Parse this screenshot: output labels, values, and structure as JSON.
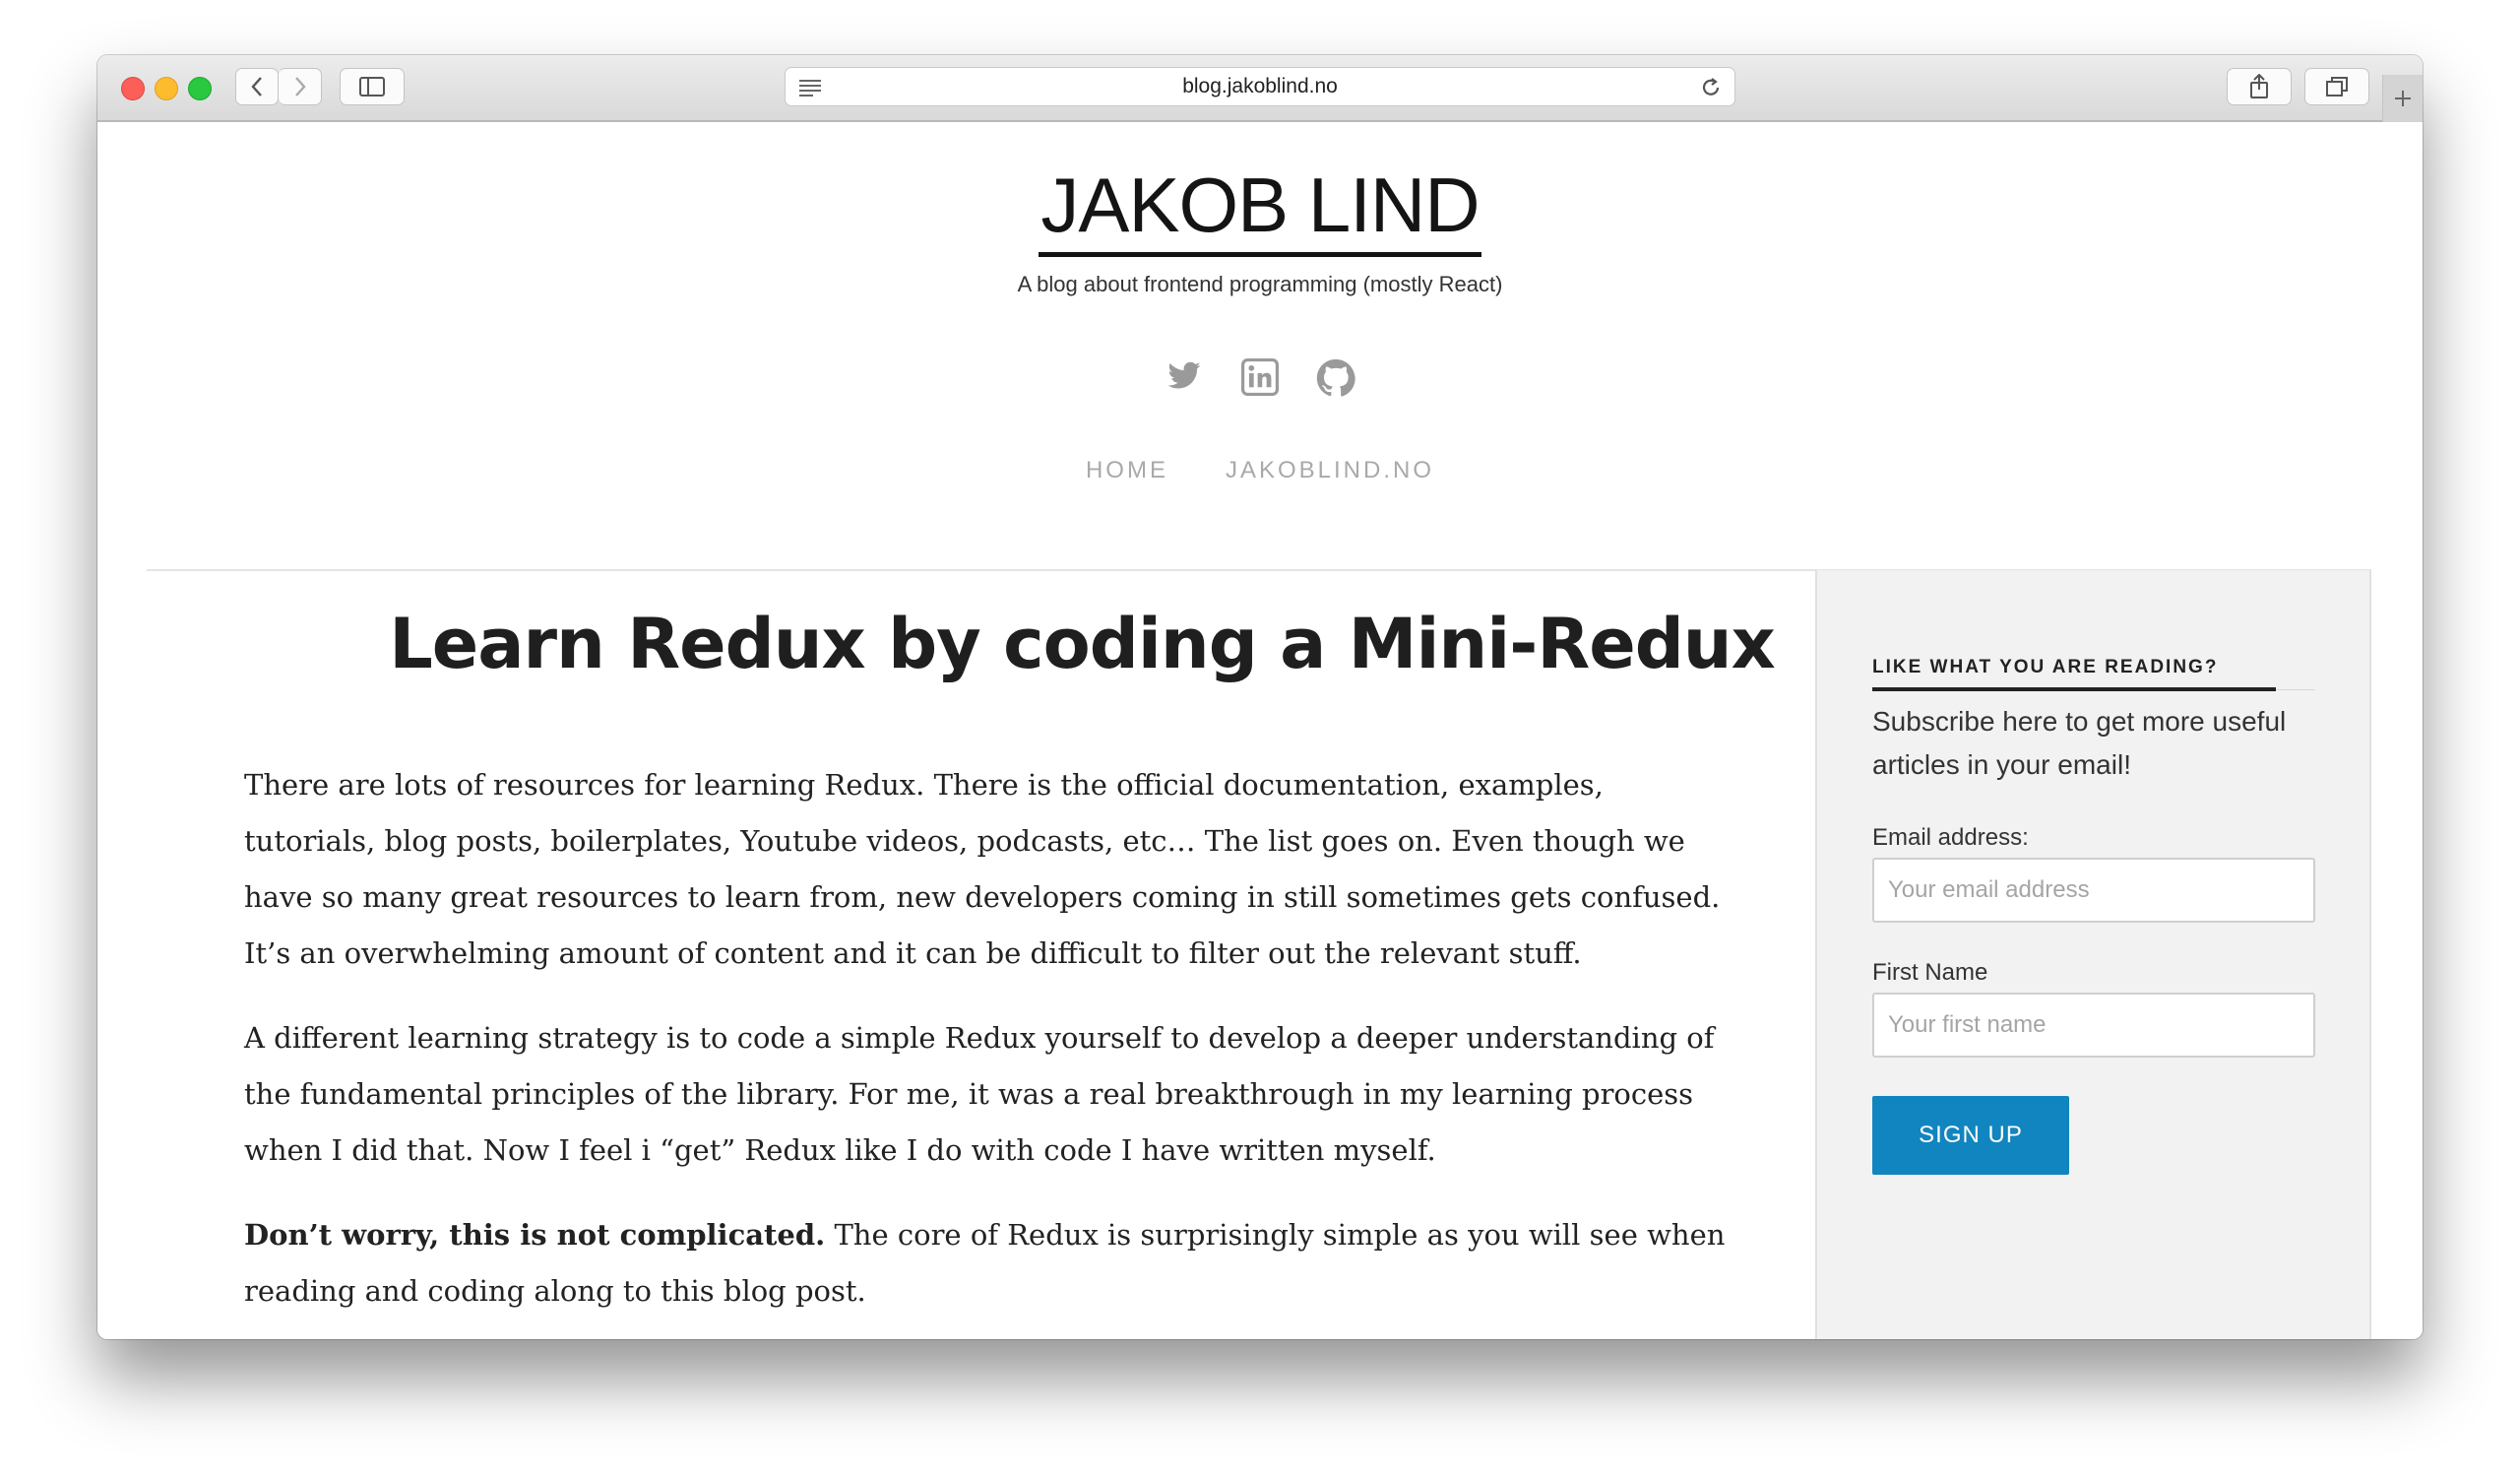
{
  "browser": {
    "url": "blog.jakoblind.no"
  },
  "site": {
    "title": "JAKOB LIND",
    "tagline": "A blog about frontend programming (mostly React)",
    "social_icons": [
      "twitter-icon",
      "linkedin-icon",
      "github-icon"
    ],
    "nav": [
      "HOME",
      "JAKOBLIND.NO"
    ]
  },
  "article": {
    "title": "Learn Redux by coding a Mini-Redux",
    "p1": "There are lots of resources for learning Redux. There is the official documentation, examples, tutorials, blog posts, boilerplates, Youtube videos, podcasts, etc… The list goes on. Even though we have so many great resources to learn from, new developers coming in still sometimes gets confused. It’s an over­whelming amount of content and it can be difficult to filter out the relevant stuff.",
    "p2": "A different learning strategy is to code a simple Redux yourself to develop a deeper understanding of the fundamental principles of the library. For me, it was a real breakthrough in my learning process when I did that. Now I feel i “get” Redux like I do with code I have written myself.",
    "p3_bold": "Don’t worry, this is not complicated.",
    "p3_rest": " The core of Redux is surprisingly simple as you will see when reading and coding along to this blog post."
  },
  "sidebar": {
    "heading": "LIKE WHAT YOU ARE READING?",
    "text": "Subscribe here to get more useful articles in your email!",
    "email_label": "Email address:",
    "email_placeholder": "Your email address",
    "name_label": "First Name",
    "name_placeholder": "Your first name",
    "button": "SIGN UP"
  },
  "colors": {
    "accent": "#1185bf",
    "sidebar_bg": "#f2f2f2",
    "nav": "#a9a9a9"
  }
}
